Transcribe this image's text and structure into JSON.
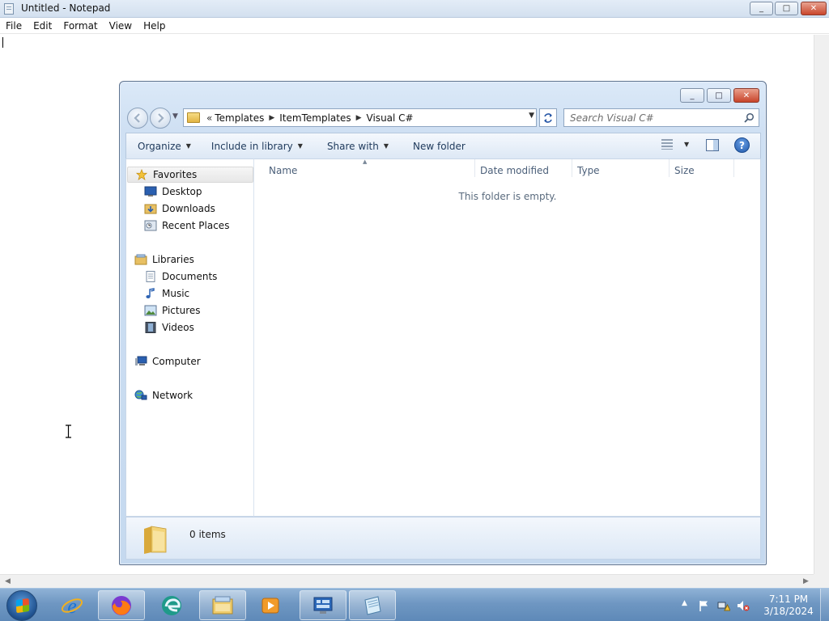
{
  "notepad": {
    "title": "Untitled - Notepad",
    "menu": [
      "File",
      "Edit",
      "Format",
      "View",
      "Help"
    ],
    "controls": {
      "minimize": "_",
      "maximize": "□",
      "close": "✕"
    },
    "text": ""
  },
  "explorer": {
    "controls": {
      "minimize": "_",
      "maximize": "□",
      "close": "✕"
    },
    "address": {
      "overflow": "«",
      "crumbs": [
        "Templates",
        "ItemTemplates",
        "Visual C#"
      ],
      "separator": "▶"
    },
    "search_placeholder": "Search Visual C#",
    "toolbar": {
      "organize": "Organize",
      "include_in_library": "Include in library",
      "share_with": "Share with",
      "new_folder": "New folder",
      "help": "?"
    },
    "nav": {
      "favorites": "Favorites",
      "favorites_items": [
        "Desktop",
        "Downloads",
        "Recent Places"
      ],
      "libraries": "Libraries",
      "libraries_items": [
        "Documents",
        "Music",
        "Pictures",
        "Videos"
      ],
      "computer": "Computer",
      "network": "Network"
    },
    "columns": [
      "Name",
      "Date modified",
      "Type",
      "Size"
    ],
    "empty_message": "This folder is empty.",
    "status_count": "0 items"
  },
  "taskbar": {
    "tasks": [
      "Internet Explorer",
      "Firefox",
      "Edge",
      "Windows Explorer",
      "Media Player",
      "Control Panel",
      "Notepad"
    ],
    "clock": {
      "time": "7:11 PM",
      "date": "3/18/2024"
    }
  },
  "colors": {
    "accent": "#2b5aa8",
    "taskbar": "#6f97c2",
    "close_button": "#c8442a"
  }
}
